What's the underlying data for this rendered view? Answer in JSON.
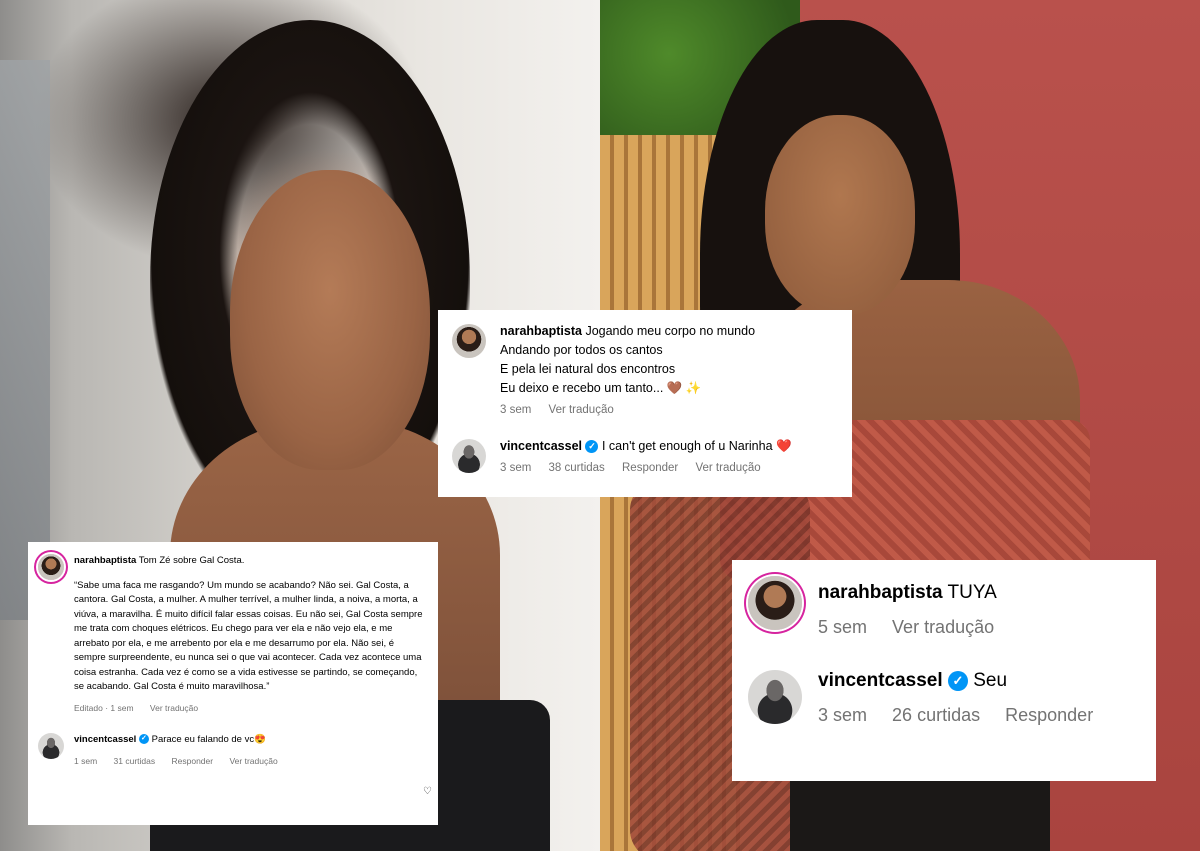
{
  "card_left": {
    "comment": {
      "username": "narahbaptista",
      "text_intro": "Tom Zé sobre Gal Costa.",
      "quote": "“Sabe uma faca me rasgando? Um mundo se acabando? Não sei. Gal Costa, a cantora. Gal Costa, a mulher. A mulher terrível, a mulher linda, a noiva, a morta, a viúva, a maravilha. É muito difícil falar essas coisas. Eu não sei, Gal Costa sempre me trata com choques elétricos. Eu chego para ver ela e não vejo ela, e me arrebato por ela, e me arrebento por ela e me desarrumo por ela. Não sei, é sempre surpreendente, eu nunca sei o que vai acontecer. Cada vez acontece uma coisa estranha. Cada vez é como se a vida estivesse se partindo, se começando, se acabando. Gal Costa é muito maravilhosa.”",
      "time": "Editado · 1 sem",
      "translate": "Ver tradução"
    },
    "reply": {
      "username": "vincentcassel",
      "text": "Parace eu falando de vc",
      "emoji": "😍",
      "time": "1 sem",
      "likes": "31 curtidas",
      "reply_label": "Responder",
      "translate": "Ver tradução"
    }
  },
  "card_center": {
    "comment": {
      "username": "narahbaptista",
      "lines": [
        "Jogando meu corpo no mundo",
        "Andando por todos os cantos",
        "E pela lei natural dos encontros",
        "Eu deixo e recebo um tanto..."
      ],
      "emoji": "🤎 ✨",
      "time": "3 sem",
      "translate": "Ver tradução"
    },
    "reply": {
      "username": "vincentcassel",
      "text": "I can't get enough of u Narinha",
      "emoji": "❤️",
      "time": "3 sem",
      "likes": "38 curtidas",
      "reply_label": "Responder",
      "translate": "Ver tradução"
    }
  },
  "card_right": {
    "comment": {
      "username": "narahbaptista",
      "text": "TUYA",
      "time": "5 sem",
      "translate": "Ver tradução"
    },
    "reply": {
      "username": "vincentcassel",
      "text": "Seu",
      "time": "3 sem",
      "likes": "26 curtidas",
      "reply_label": "Responder"
    }
  },
  "icons": [
    "verified-badge-icon",
    "heart-like-icon"
  ],
  "colors": {
    "verified": "#0095f6",
    "meta_text": "#737373",
    "story_ring": "#d6249f"
  }
}
